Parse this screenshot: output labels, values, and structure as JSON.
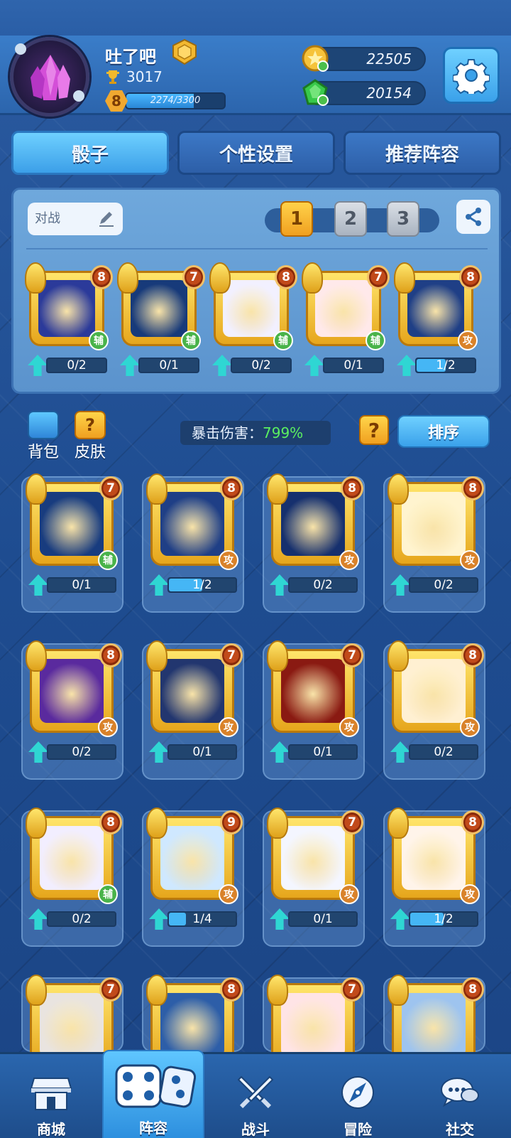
{
  "player": {
    "name": "吐了吧",
    "trophies": "3017",
    "level": "8",
    "xp_text": "2274/3300",
    "xp_fraction": 0.69
  },
  "currency": {
    "gold": "22505",
    "gems": "20154"
  },
  "tabs": [
    {
      "label": "骰子",
      "active": true
    },
    {
      "label": "个性设置",
      "active": false
    },
    {
      "label": "推荐阵容",
      "active": false
    }
  ],
  "lineup": {
    "mode_label": "对战",
    "deck_numbers": [
      "1",
      "2",
      "3"
    ],
    "active_deck": 0
  },
  "lineup_cards": [
    {
      "icon": "twin-figures-icon",
      "level": "8",
      "role": "辅",
      "role_type": "fu",
      "progress": "0/2",
      "fraction": 0,
      "art": "#2b3a9a"
    },
    {
      "icon": "libra-scales-icon",
      "level": "7",
      "role": "辅",
      "role_type": "fu",
      "progress": "0/1",
      "fraction": 0,
      "art": "#173a7a"
    },
    {
      "icon": "purple-altar-icon",
      "level": "8",
      "role": "辅",
      "role_type": "fu",
      "progress": "0/2",
      "fraction": 0,
      "art": "#f2f0ff"
    },
    {
      "icon": "red-drum-icon",
      "level": "7",
      "role": "辅",
      "role_type": "fu",
      "progress": "0/1",
      "fraction": 0,
      "art": "#ffe9ea"
    },
    {
      "icon": "virgo-silhouette-icon",
      "level": "8",
      "role": "攻",
      "role_type": "gong",
      "progress": "1/2",
      "fraction": 0.5,
      "art": "#1f3f86"
    }
  ],
  "middle": {
    "bag_label": "背包",
    "skin_label": "皮肤",
    "crit_label": "暴击伤害：",
    "crit_value": "799%",
    "help_glyph": "?",
    "sort_label": "排序"
  },
  "collection": [
    {
      "icon": "libra-scales-icon",
      "level": "7",
      "role": "辅",
      "role_type": "fu",
      "progress": "0/1",
      "fraction": 0,
      "art": "#183c7f"
    },
    {
      "icon": "virgo-silhouette-icon",
      "level": "8",
      "role": "攻",
      "role_type": "gong",
      "progress": "1/2",
      "fraction": 0.5,
      "art": "#1f3f86"
    },
    {
      "icon": "scorpion-icon",
      "level": "8",
      "role": "攻",
      "role_type": "gong",
      "progress": "0/2",
      "fraction": 0,
      "art": "#16306e"
    },
    {
      "icon": "holy-cross-icon",
      "level": "8",
      "role": "攻",
      "role_type": "gong",
      "progress": "0/2",
      "fraction": 0,
      "art": "#fff4cf"
    },
    {
      "icon": "purple-beam-icon",
      "level": "8",
      "role": "攻",
      "role_type": "gong",
      "progress": "0/2",
      "fraction": 0,
      "art": "#5a2a9e"
    },
    {
      "icon": "blue-lotus-icon",
      "level": "7",
      "role": "攻",
      "role_type": "gong",
      "progress": "0/1",
      "fraction": 0,
      "art": "#22366f"
    },
    {
      "icon": "fire-blast-icon",
      "level": "7",
      "role": "攻",
      "role_type": "gong",
      "progress": "0/1",
      "fraction": 0,
      "art": "#8a1a12"
    },
    {
      "icon": "golden-bull-icon",
      "level": "8",
      "role": "攻",
      "role_type": "gong",
      "progress": "0/2",
      "fraction": 0,
      "art": "#fff0d2"
    },
    {
      "icon": "purple-altar-icon",
      "level": "8",
      "role": "辅",
      "role_type": "fu",
      "progress": "0/2",
      "fraction": 0,
      "art": "#f2eeff"
    },
    {
      "icon": "ice-sword-icon",
      "level": "9",
      "role": "攻",
      "role_type": "gong",
      "progress": "1/4",
      "fraction": 0.25,
      "art": "#cfe8ff"
    },
    {
      "icon": "lightning-sword-icon",
      "level": "7",
      "role": "攻",
      "role_type": "gong",
      "progress": "0/1",
      "fraction": 0,
      "art": "#f4f6ff"
    },
    {
      "icon": "flame-banner-icon",
      "level": "8",
      "role": "攻",
      "role_type": "gong",
      "progress": "1/2",
      "fraction": 0.5,
      "art": "#fff4ea"
    },
    {
      "icon": "volcano-icon",
      "level": "7",
      "role": "",
      "role_type": "",
      "progress": "",
      "fraction": 0,
      "art": "#e9e4e0"
    },
    {
      "icon": "moon-maiden-icon",
      "level": "8",
      "role": "",
      "role_type": "",
      "progress": "",
      "fraction": 0,
      "art": "#2d5ea8"
    },
    {
      "icon": "paw-print-icon",
      "level": "7",
      "role": "",
      "role_type": "",
      "progress": "",
      "fraction": 0,
      "art": "#ffe4e6"
    },
    {
      "icon": "full-moon-icon",
      "level": "8",
      "role": "",
      "role_type": "",
      "progress": "",
      "fraction": 0,
      "art": "#9ec4ef"
    }
  ],
  "nav": [
    {
      "label": "商城",
      "icon": "shop-icon",
      "active": false
    },
    {
      "label": "阵容",
      "icon": "dice-icon",
      "active": true
    },
    {
      "label": "战斗",
      "icon": "crossed-swords-icon",
      "active": false
    },
    {
      "label": "冒险",
      "icon": "compass-icon",
      "active": false
    },
    {
      "label": "社交",
      "icon": "chat-bubbles-icon",
      "active": false
    }
  ],
  "colors": {
    "accent": "#3aa1ea",
    "gold": "#f0a020",
    "support_role": "#49b34a",
    "attack_role": "#d9822a",
    "crit_value": "#5bf060"
  }
}
